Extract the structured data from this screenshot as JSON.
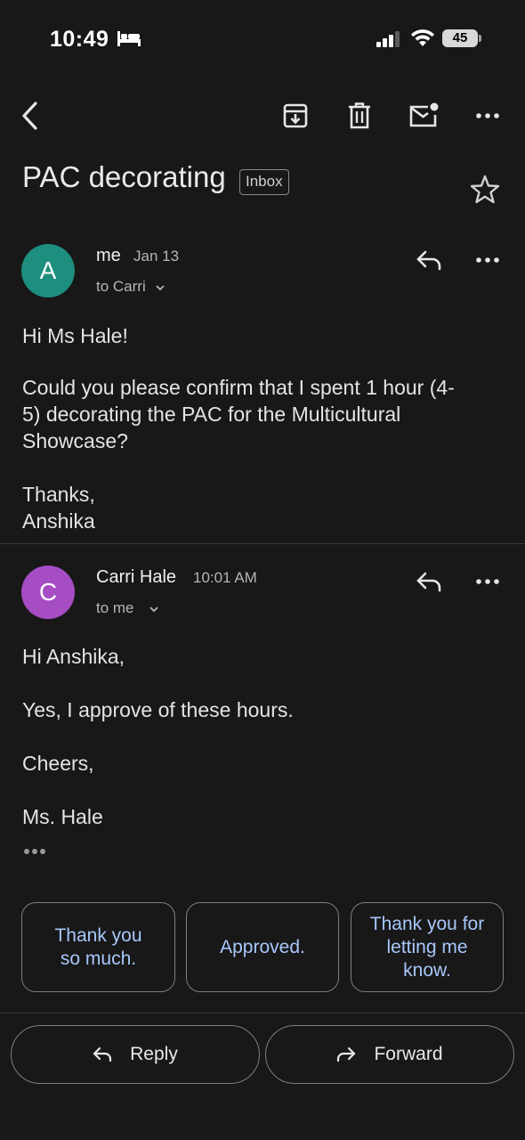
{
  "status_bar": {
    "time": "10:49",
    "battery": "45"
  },
  "toolbar": {
    "back_icon": "back-arrow-icon",
    "archive_icon": "archive-icon",
    "delete_icon": "trash-icon",
    "mark_unread_icon": "mail-unread-icon",
    "more_icon": "more-horizontal-icon"
  },
  "subject": {
    "title": "PAC decorating",
    "label": "Inbox"
  },
  "messages": [
    {
      "avatar_letter": "A",
      "avatar_color": "#1e8e7e",
      "sender": "me",
      "date": "Jan 13",
      "to": "to Carri",
      "body": [
        "Hi Ms Hale!",
        "Could you please confirm that I spent 1 hour (4-",
        "5) decorating the PAC for the Multicultural",
        "Showcase?",
        "Thanks,",
        "Anshika"
      ]
    },
    {
      "avatar_letter": "C",
      "avatar_color": "#a64dc4",
      "sender": "Carri Hale",
      "date": "10:01 AM",
      "to": "to me",
      "body": [
        "Hi Anshika,",
        "Yes, I approve of these hours.",
        "Cheers,",
        "Ms. Hale"
      ]
    }
  ],
  "smart_replies": [
    [
      "Thank you",
      "so much."
    ],
    [
      "Approved."
    ],
    [
      "Thank you for",
      "letting me",
      "know."
    ]
  ],
  "actions": {
    "reply": "Reply",
    "forward": "Forward"
  },
  "colors": {
    "background": "#181818",
    "accent_text": "#a8c7fa"
  }
}
